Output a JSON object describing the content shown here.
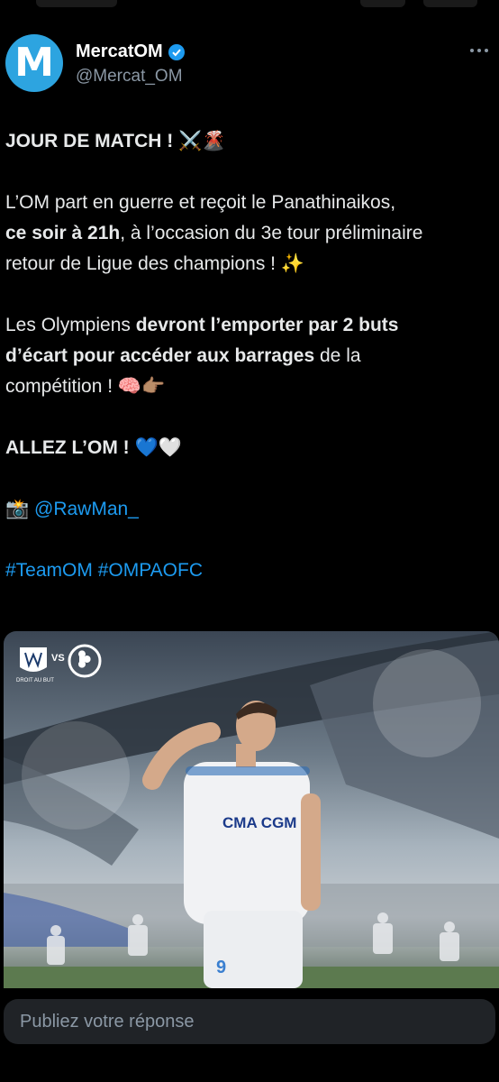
{
  "account": {
    "name": "MercatOM",
    "handle": "@Mercat_OM",
    "avatar_letter": "M"
  },
  "tweet": {
    "line1": "JOUR DE MATCH ! ⚔️🌋",
    "p2_a": "L’OM part en guerre et reçoit le Panathinaikos,",
    "p2_b_bold": "ce soir à 21h",
    "p2_b_rest": ", à l’occasion du 3e tour préliminaire",
    "p2_c": "retour de Ligue des champions ! ✨",
    "p3_a": "Les Olympiens ",
    "p3_a_bold": "devront l’emporter par 2 buts",
    "p3_b_bold": "d’écart pour accéder aux barrages",
    "p3_b_rest": " de la",
    "p3_c": "compétition ! 🧠👉🏽",
    "p4": "ALLEZ L’OM ! 💙🤍",
    "credit_icon": "📸",
    "credit_mention": "@RawMan_",
    "hashtags": "#TeamOM #OMPAOFC"
  },
  "media": {
    "vs_text": "VS",
    "club_motto": "DROIT AU BUT",
    "jersey_sponsor": "CMA CGM",
    "shorts_number": "9"
  },
  "reply": {
    "placeholder": "Publiez votre réponse"
  },
  "colors": {
    "background": "#000000",
    "accent": "#1d9bf0",
    "avatar": "#2da4e0"
  }
}
